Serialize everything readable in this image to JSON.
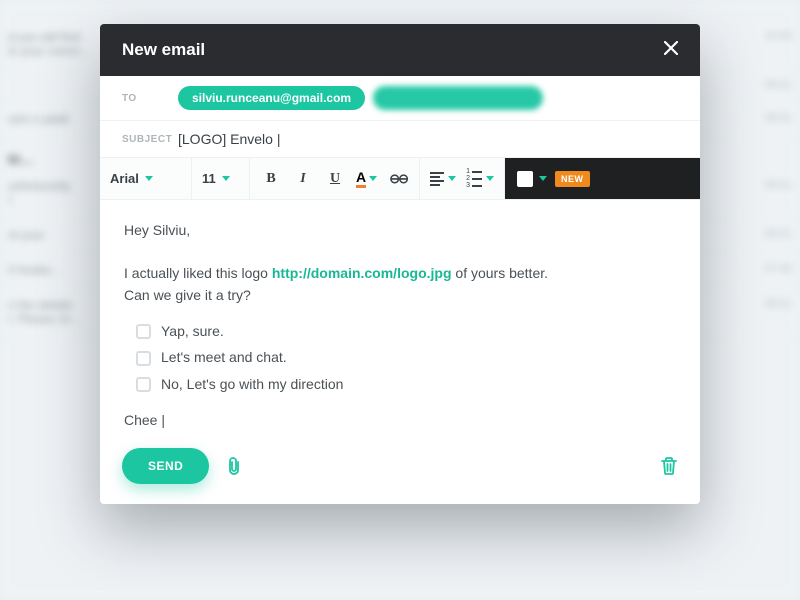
{
  "bg": {
    "rows": [
      {
        "text": "d you will find in your comm…",
        "time": "10:43"
      },
      {
        "text": "",
        "time": "09:21"
      },
      {
        "text": "vem e platit",
        "time": "09:21"
      },
      {
        "bold": "kt…"
      },
      {
        "text": "unfortunetly I",
        "time": "09:21"
      },
      {
        "text": "nt your",
        "time": "09:21"
      },
      {
        "text": "II hooke…",
        "time": "07:40"
      },
      {
        "text": "n the details I. Please ch…",
        "time": "09:21"
      }
    ]
  },
  "header": {
    "title": "New email"
  },
  "fields": {
    "to_label": "TO",
    "chips": [
      "silviu.runceanu@gmail.com"
    ],
    "subject_label": "SUBJECT",
    "subject_value": "[LOGO] Envelo |"
  },
  "toolbar": {
    "font": "Arial",
    "size": "11",
    "new_badge": "NEW"
  },
  "body": {
    "greeting": "Hey Silviu,",
    "line1_a": "I actually liked this logo ",
    "link": "http://domain.com/logo.jpg",
    "line1_b": " of yours better.",
    "line2": "Can we give it a try?",
    "checks": [
      "Yap, sure.",
      "Let's meet and chat.",
      "No, Let's go with my direction"
    ],
    "sign": "Chee |"
  },
  "footer": {
    "send": "SEND"
  }
}
